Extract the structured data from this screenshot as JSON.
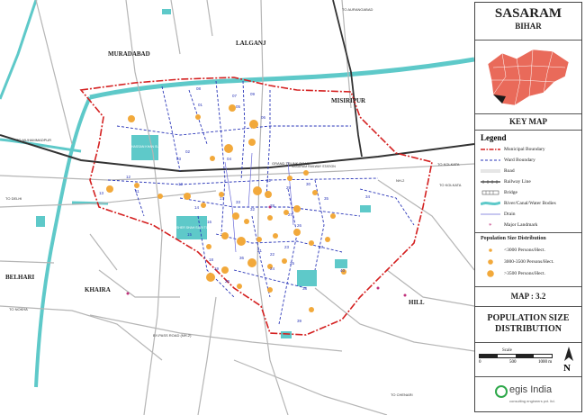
{
  "title": {
    "city": "SASARAM",
    "state": "BIHAR"
  },
  "key_map": {
    "label": "KEY MAP"
  },
  "legend": {
    "heading": "Legend",
    "items": [
      {
        "label": "Municipal Boundary",
        "symbol": "municipal-boundary",
        "color": "#d42020"
      },
      {
        "label": "Ward Boundary",
        "symbol": "ward-boundary",
        "color": "#2a36b8"
      },
      {
        "label": "Road",
        "symbol": "road",
        "color": "#9a9a9a"
      },
      {
        "label": "Railway Line",
        "symbol": "railway",
        "color": "#333333"
      },
      {
        "label": "Bridge",
        "symbol": "bridge",
        "color": "#555555"
      },
      {
        "label": "River/Canal/Water Bodies",
        "symbol": "water",
        "color": "#5ec9c9"
      },
      {
        "label": "Drain",
        "symbol": "drain",
        "color": "#6a6ad8"
      },
      {
        "label": "Major Landmark",
        "symbol": "landmark",
        "color": "#c0307a"
      }
    ],
    "population_heading": "Population Size Distribution",
    "population_items": [
      {
        "label": "<3000 Persons/Hect.",
        "size": "small",
        "color": "#f2a93b"
      },
      {
        "label": "3000-3500 Persons/Hect.",
        "size": "medium",
        "color": "#f2a93b"
      },
      {
        "label": ">3500 Persons/Hect.",
        "size": "large",
        "color": "#f2a93b"
      }
    ]
  },
  "map_number": "MAP : 3.2",
  "map_title_line1": "POPULATION SIZE",
  "map_title_line2": "DISTRIBUTION",
  "scale": {
    "label": "Scale",
    "ticks": [
      "0",
      "500",
      "1000 m"
    ]
  },
  "north": "N",
  "logo": {
    "brand": "egis India",
    "tagline": "consulting engineers pvt. ltd."
  },
  "places": {
    "muradabad": "MURADABAD",
    "lalganj": "LALGANJ",
    "misiripur": "MISIRIPUR",
    "belhari": "BELHARI",
    "khaira": "KHAIRA",
    "hill": "HILL"
  },
  "road_labels": {
    "to_muhammadpur": "TO MUHAMMADPUR",
    "to_delhi": "TO DELHI",
    "to_kolkata_1": "TO KOLKATA",
    "to_kolkata_2": "TO KOLKATA",
    "nh2": "NH-2",
    "grand_trunk": "GRAND TRUNK ROAD",
    "bypass": "BY-PASS ROAD (NH-2)",
    "to_chenari": "TO CHENARI",
    "railway_station": "SASARAM RAILWAY STATION",
    "sher_shah_tomb": "SHER SHAH SURI TOMB",
    "hassan_khan_tomb": "HASSAN KHAN SURI TOMB",
    "to_nokha": "TO NOKHA",
    "to_aurangabad": "TO AURANGABAD"
  },
  "ward_numbers": [
    "01",
    "02",
    "03",
    "04",
    "05",
    "06",
    "07",
    "08",
    "09",
    "10",
    "11",
    "12",
    "13",
    "14",
    "15",
    "16",
    "17",
    "18",
    "19",
    "20",
    "21",
    "22",
    "23",
    "24",
    "25",
    "26",
    "27",
    "28",
    "29",
    "30",
    "31",
    "32",
    "33",
    "34",
    "35",
    "36",
    "37",
    "38",
    "39",
    "40"
  ],
  "chart_data": {
    "type": "scatter",
    "title": "POPULATION SIZE DISTRIBUTION",
    "classes": [
      "<3000 Persons/Hect.",
      "3000-3500 Persons/Hect.",
      ">3500 Persons/Hect."
    ]
  }
}
